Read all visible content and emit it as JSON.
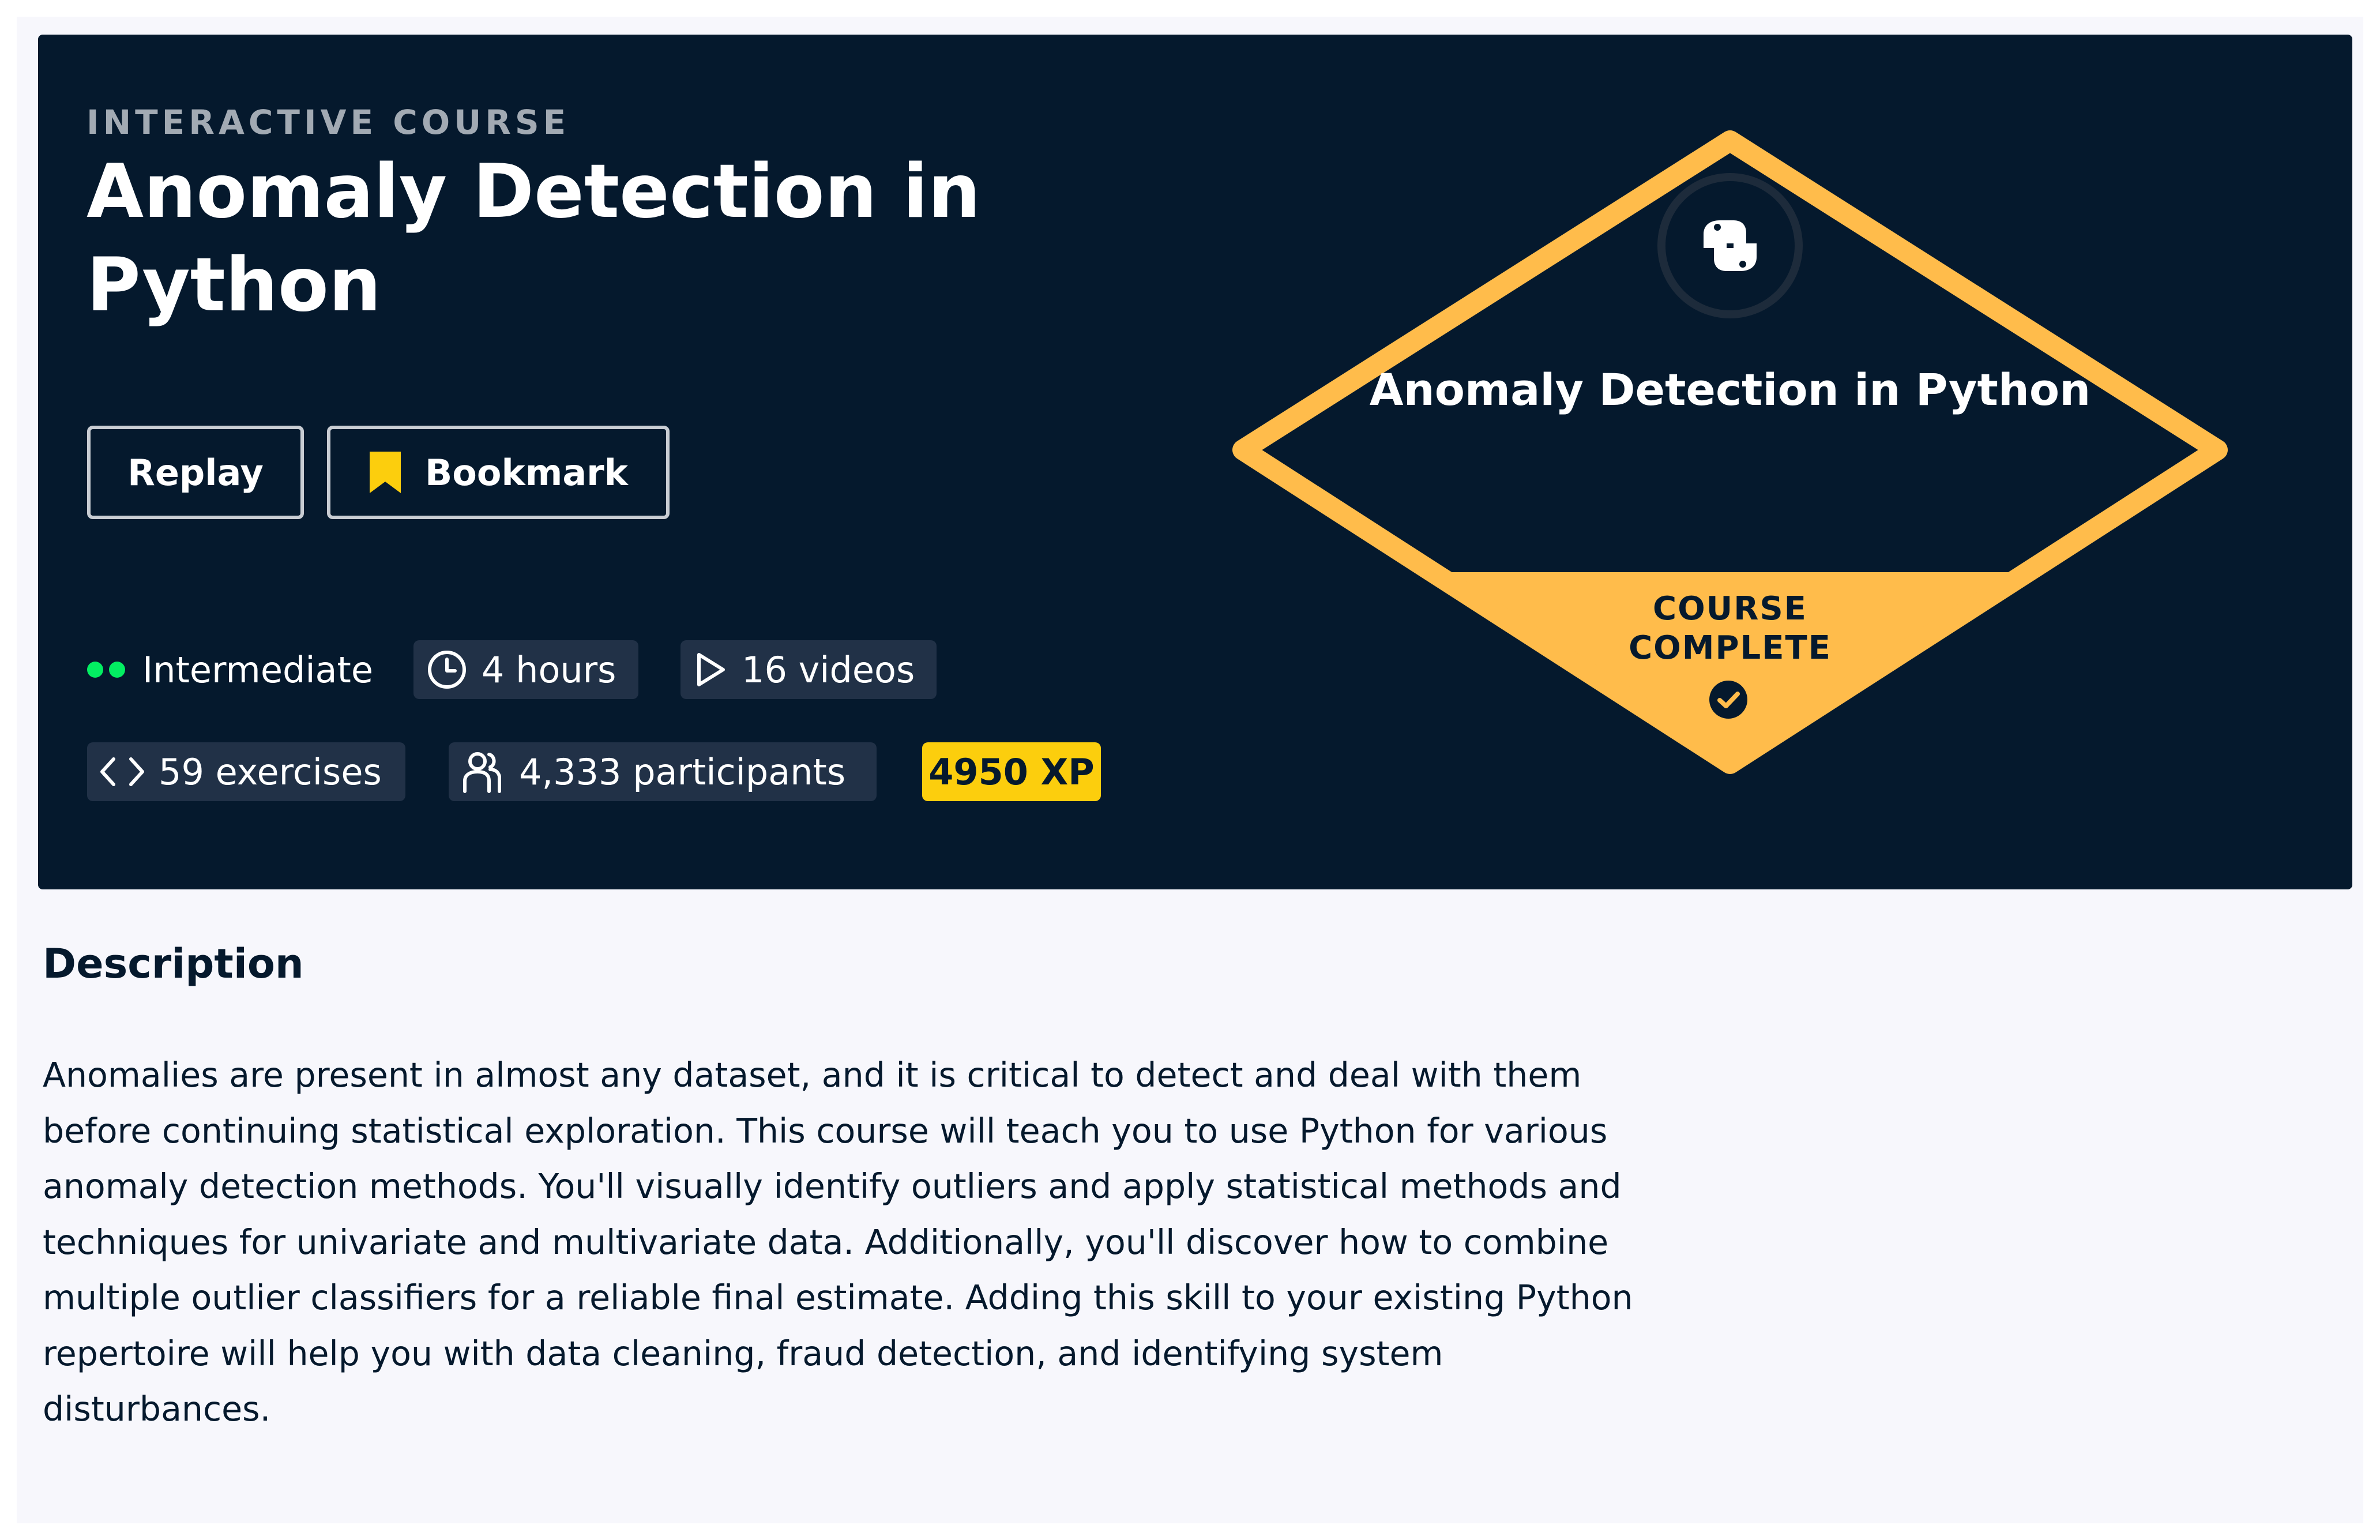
{
  "course": {
    "eyebrow": "INTERACTIVE COURSE",
    "title": "Anomaly Detection in Python"
  },
  "actions": {
    "replay_label": "Replay",
    "bookmark_label": "Bookmark",
    "bookmark_icon": "bookmark-icon"
  },
  "meta": {
    "level": "Intermediate",
    "duration": "4 hours",
    "videos": "16 videos",
    "exercises": "59 exercises",
    "participants": "4,333 participants",
    "xp": "4950 XP"
  },
  "badge": {
    "icon": "python-logo-icon",
    "title": "Anomaly Detection in Python",
    "status_line1": "COURSE",
    "status_line2": "COMPLETE",
    "status_icon": "check-circle-icon"
  },
  "description": {
    "heading": "Description",
    "text": "Anomalies are present in almost any dataset, and it is critical to detect and deal with them before continuing statistical exploration. This course will teach you to use Python for various anomaly detection methods. You'll visually identify outliers and apply statistical methods and techniques for univariate and multivariate data. Additionally, you'll discover how to combine multiple outlier classifiers for a reliable final estimate. Adding this skill to your existing Python repertoire will help you with data cleaning, fraud detection, and identifying system disturbances."
  },
  "colors": {
    "hero_background": "#05192d",
    "chip_background": "#213147",
    "level_dot": "#03ef62",
    "xp_badge": "#fcce0d",
    "badge_outline": "#ffbc4b",
    "bookmark_icon": "#fcce0d",
    "page_background": "#f7f7fc"
  }
}
